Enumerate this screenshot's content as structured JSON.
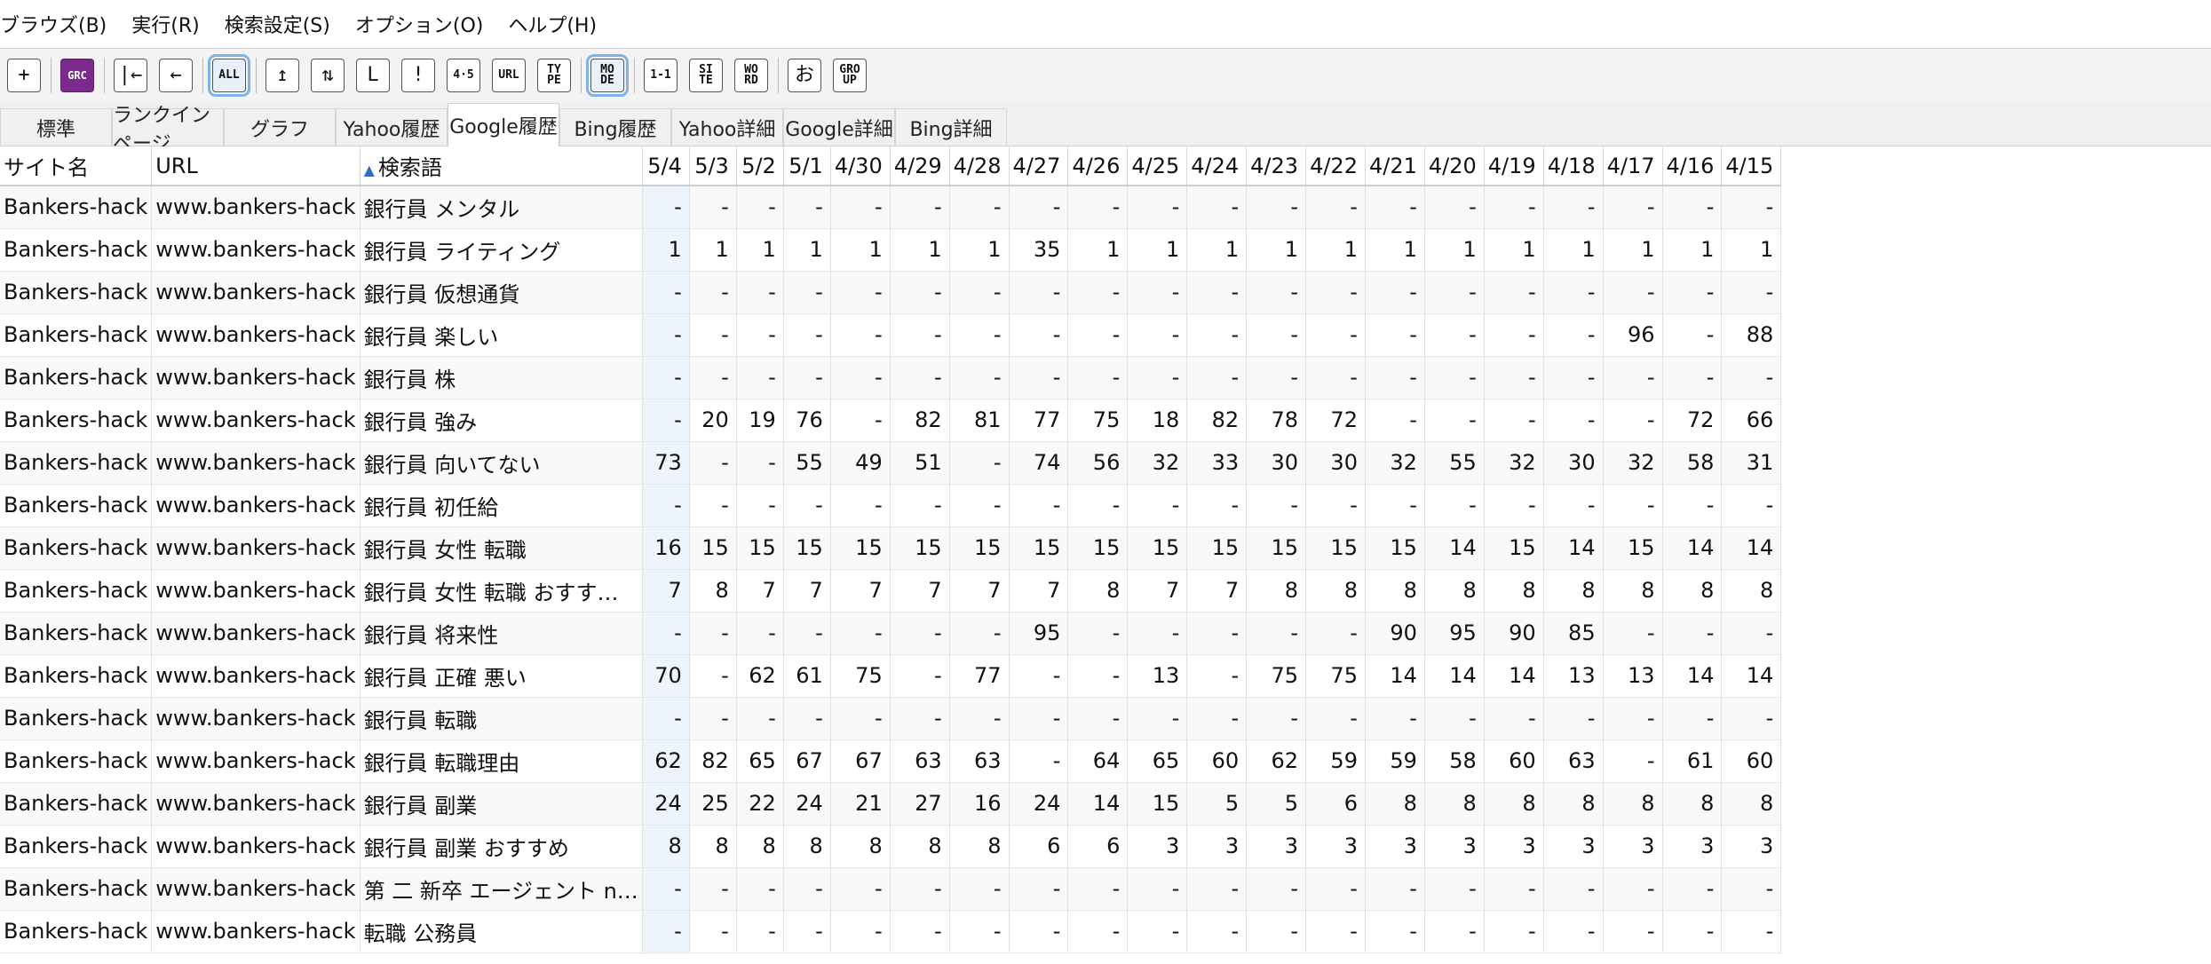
{
  "menu": [
    "ブラウズ(B)",
    "実行(R)",
    "検索設定(S)",
    "オプション(O)",
    "ヘルプ(H)"
  ],
  "toolbar": [
    {
      "name": "add-button",
      "label": "+",
      "icon": "add-window-icon",
      "active": false,
      "style": "big"
    },
    {
      "sep": true
    },
    {
      "name": "grc-button",
      "label": "GRC",
      "icon": "grc-logo-icon",
      "active": false,
      "style": "purple"
    },
    {
      "sep": true
    },
    {
      "name": "first-button",
      "label": "|←",
      "icon": "skip-first-icon",
      "active": false,
      "style": "big"
    },
    {
      "name": "back-button",
      "label": "←",
      "icon": "arrow-left-icon",
      "active": false,
      "style": "big"
    },
    {
      "sep": true
    },
    {
      "name": "all-button",
      "label": "ALL",
      "icon": "all-icon",
      "active": true,
      "style": ""
    },
    {
      "sep": true
    },
    {
      "name": "up-button",
      "label": "↥",
      "icon": "arrow-up-bar-icon",
      "active": false,
      "style": "big"
    },
    {
      "name": "updown-button",
      "label": "⇅",
      "icon": "updown-icon",
      "active": false,
      "style": "big"
    },
    {
      "name": "l-button",
      "label": "L",
      "icon": "l-shape-icon",
      "active": false,
      "style": "big"
    },
    {
      "name": "exclaim-button",
      "label": "!",
      "icon": "exclamation-icon",
      "active": false,
      "style": "big"
    },
    {
      "name": "45-button",
      "label": "4·5",
      "icon": "four-five-icon",
      "active": false,
      "style": ""
    },
    {
      "name": "url-button",
      "label": "URL",
      "icon": "url-icon",
      "active": false,
      "style": ""
    },
    {
      "name": "type-button",
      "label": "TY PE",
      "icon": "type-icon",
      "active": false,
      "style": ""
    },
    {
      "sep": true
    },
    {
      "name": "mode-button",
      "label": "MO DE",
      "icon": "mode-icon",
      "active": true,
      "style": ""
    },
    {
      "sep": true
    },
    {
      "name": "one-one-button",
      "label": "1-1",
      "icon": "one-one-icon",
      "active": false,
      "style": ""
    },
    {
      "name": "site-button",
      "label": "SI TE",
      "icon": "site-icon",
      "active": false,
      "style": ""
    },
    {
      "name": "word-button",
      "label": "WO RD",
      "icon": "word-icon",
      "active": false,
      "style": ""
    },
    {
      "sep": true
    },
    {
      "name": "o-button",
      "label": "お",
      "icon": "hiragana-o-icon",
      "active": false,
      "style": "big"
    },
    {
      "name": "group-button",
      "label": "GRO UP",
      "icon": "group-icon",
      "active": false,
      "style": ""
    }
  ],
  "tabs": [
    {
      "label": "標準",
      "selected": false
    },
    {
      "label": "ランクインページ",
      "selected": false
    },
    {
      "label": "グラフ",
      "selected": false
    },
    {
      "label": "Yahoo履歴",
      "selected": false
    },
    {
      "label": "Google履歴",
      "selected": true
    },
    {
      "label": "Bing履歴",
      "selected": false
    },
    {
      "label": "Yahoo詳細",
      "selected": false
    },
    {
      "label": "Google詳細",
      "selected": false
    },
    {
      "label": "Bing詳細",
      "selected": false
    }
  ],
  "table": {
    "headers": [
      "サイト名",
      "URL",
      "検索語",
      "5/4",
      "5/3",
      "5/2",
      "5/1",
      "4/30",
      "4/29",
      "4/28",
      "4/27",
      "4/26",
      "4/25",
      "4/24",
      "4/23",
      "4/22",
      "4/21",
      "4/20",
      "4/19",
      "4/18",
      "4/17",
      "4/16",
      "4/15"
    ],
    "rows": [
      [
        "Bankers-hack",
        "www.bankers-hack",
        "銀行員 メンタル",
        "-",
        "-",
        "-",
        "-",
        "-",
        "-",
        "-",
        "-",
        "-",
        "-",
        "-",
        "-",
        "-",
        "-",
        "-",
        "-",
        "-",
        "-",
        "-",
        "-"
      ],
      [
        "Bankers-hack",
        "www.bankers-hack",
        "銀行員 ライティング",
        "1",
        "1",
        "1",
        "1",
        "1",
        "1",
        "1",
        "35",
        "1",
        "1",
        "1",
        "1",
        "1",
        "1",
        "1",
        "1",
        "1",
        "1",
        "1",
        "1"
      ],
      [
        "Bankers-hack",
        "www.bankers-hack",
        "銀行員 仮想通貨",
        "-",
        "-",
        "-",
        "-",
        "-",
        "-",
        "-",
        "-",
        "-",
        "-",
        "-",
        "-",
        "-",
        "-",
        "-",
        "-",
        "-",
        "-",
        "-",
        "-"
      ],
      [
        "Bankers-hack",
        "www.bankers-hack",
        "銀行員 楽しい",
        "-",
        "-",
        "-",
        "-",
        "-",
        "-",
        "-",
        "-",
        "-",
        "-",
        "-",
        "-",
        "-",
        "-",
        "-",
        "-",
        "-",
        "96",
        "-",
        "88"
      ],
      [
        "Bankers-hack",
        "www.bankers-hack",
        "銀行員 株",
        "-",
        "-",
        "-",
        "-",
        "-",
        "-",
        "-",
        "-",
        "-",
        "-",
        "-",
        "-",
        "-",
        "-",
        "-",
        "-",
        "-",
        "-",
        "-",
        "-"
      ],
      [
        "Bankers-hack",
        "www.bankers-hack",
        "銀行員 強み",
        "-",
        "20",
        "19",
        "76",
        "-",
        "82",
        "81",
        "77",
        "75",
        "18",
        "82",
        "78",
        "72",
        "-",
        "-",
        "-",
        "-",
        "-",
        "72",
        "66"
      ],
      [
        "Bankers-hack",
        "www.bankers-hack",
        "銀行員 向いてない",
        "73",
        "-",
        "-",
        "55",
        "49",
        "51",
        "-",
        "74",
        "56",
        "32",
        "33",
        "30",
        "30",
        "32",
        "55",
        "32",
        "30",
        "32",
        "58",
        "31"
      ],
      [
        "Bankers-hack",
        "www.bankers-hack",
        "銀行員 初任給",
        "-",
        "-",
        "-",
        "-",
        "-",
        "-",
        "-",
        "-",
        "-",
        "-",
        "-",
        "-",
        "-",
        "-",
        "-",
        "-",
        "-",
        "-",
        "-",
        "-"
      ],
      [
        "Bankers-hack",
        "www.bankers-hack",
        "銀行員 女性 転職",
        "16",
        "15",
        "15",
        "15",
        "15",
        "15",
        "15",
        "15",
        "15",
        "15",
        "15",
        "15",
        "15",
        "15",
        "14",
        "15",
        "14",
        "15",
        "14",
        "14"
      ],
      [
        "Bankers-hack",
        "www.bankers-hack",
        "銀行員 女性 転職 おすす…",
        "7",
        "8",
        "7",
        "7",
        "7",
        "7",
        "7",
        "7",
        "8",
        "7",
        "7",
        "8",
        "8",
        "8",
        "8",
        "8",
        "8",
        "8",
        "8",
        "8"
      ],
      [
        "Bankers-hack",
        "www.bankers-hack",
        "銀行員 将来性",
        "-",
        "-",
        "-",
        "-",
        "-",
        "-",
        "-",
        "95",
        "-",
        "-",
        "-",
        "-",
        "-",
        "90",
        "95",
        "90",
        "85",
        "-",
        "-",
        "-"
      ],
      [
        "Bankers-hack",
        "www.bankers-hack",
        "銀行員 正確 悪い",
        "70",
        "-",
        "62",
        "61",
        "75",
        "-",
        "77",
        "-",
        "-",
        "13",
        "-",
        "75",
        "75",
        "14",
        "14",
        "14",
        "13",
        "13",
        "14",
        "14"
      ],
      [
        "Bankers-hack",
        "www.bankers-hack",
        "銀行員 転職",
        "-",
        "-",
        "-",
        "-",
        "-",
        "-",
        "-",
        "-",
        "-",
        "-",
        "-",
        "-",
        "-",
        "-",
        "-",
        "-",
        "-",
        "-",
        "-",
        "-"
      ],
      [
        "Bankers-hack",
        "www.bankers-hack",
        "銀行員 転職理由",
        "62",
        "82",
        "65",
        "67",
        "67",
        "63",
        "63",
        "-",
        "64",
        "65",
        "60",
        "62",
        "59",
        "59",
        "58",
        "60",
        "63",
        "-",
        "61",
        "60"
      ],
      [
        "Bankers-hack",
        "www.bankers-hack",
        "銀行員 副業",
        "24",
        "25",
        "22",
        "24",
        "21",
        "27",
        "16",
        "24",
        "14",
        "15",
        "5",
        "5",
        "6",
        "8",
        "8",
        "8",
        "8",
        "8",
        "8",
        "8"
      ],
      [
        "Bankers-hack",
        "www.bankers-hack",
        "銀行員 副業 おすすめ",
        "8",
        "8",
        "8",
        "8",
        "8",
        "8",
        "8",
        "6",
        "6",
        "3",
        "3",
        "3",
        "3",
        "3",
        "3",
        "3",
        "3",
        "3",
        "3",
        "3"
      ],
      [
        "Bankers-hack",
        "www.bankers-hack",
        "第 二 新卒 エージェント n…",
        "-",
        "-",
        "-",
        "-",
        "-",
        "-",
        "-",
        "-",
        "-",
        "-",
        "-",
        "-",
        "-",
        "-",
        "-",
        "-",
        "-",
        "-",
        "-",
        "-"
      ],
      [
        "Bankers-hack",
        "www.bankers-hack",
        "転職 公務員",
        "-",
        "-",
        "-",
        "-",
        "-",
        "-",
        "-",
        "-",
        "-",
        "-",
        "-",
        "-",
        "-",
        "-",
        "-",
        "-",
        "-",
        "-",
        "-",
        "-"
      ]
    ]
  },
  "colors": {
    "accent": "#2f6fc9",
    "selectedColumn": "#eef4fb",
    "grc": "#7b2a8c"
  }
}
